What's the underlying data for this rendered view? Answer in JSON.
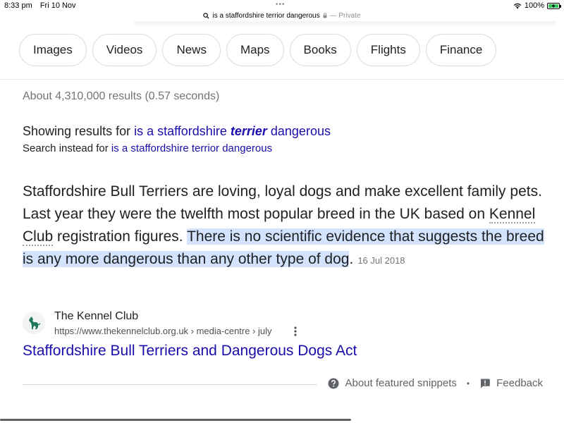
{
  "status_bar": {
    "time": "8:33 pm",
    "date": "Fri 10 Nov",
    "battery": "100%"
  },
  "address_bar": {
    "query_url": "is a staffordshire terrior dangerous",
    "private_label": "— Private"
  },
  "chips": [
    "Images",
    "Videos",
    "News",
    "Maps",
    "Books",
    "Flights",
    "Finance"
  ],
  "results": {
    "stats": "About 4,310,000 results (0.57 seconds)",
    "spell": {
      "showing_prefix": "Showing results for",
      "corrected_part1": "is a staffordshire",
      "corrected_bold": "terrier",
      "corrected_part2": "dangerous",
      "instead_prefix": "Search instead for",
      "original_query": "is a staffordshire terrior dangerous"
    },
    "featured": {
      "text_before": "Staffordshire Bull Terriers are loving, loyal dogs and make excellent family pets. Last year they were the twelfth most popular breed in the UK based on ",
      "kennel_term": "Kennel Club",
      "text_mid": " registration figures. ",
      "highlight": "There is no scientific evidence that suggests the breed is any more dangerous than any other type of dog",
      "text_end": ".",
      "date": "16 Jul 2018"
    },
    "source": {
      "name": "The Kennel Club",
      "url": "https://www.thekennelclub.org.uk › media-centre › july",
      "logo_icon": "dog-logo-icon",
      "title": "Staffordshire Bull Terriers and Dangerous Dogs Act"
    },
    "footer": {
      "about": "About featured snippets",
      "separator": "•",
      "feedback": "Feedback"
    }
  },
  "colors": {
    "link": "#1a0dab",
    "highlight": "#d3e3fd",
    "battery": "#34c759"
  }
}
